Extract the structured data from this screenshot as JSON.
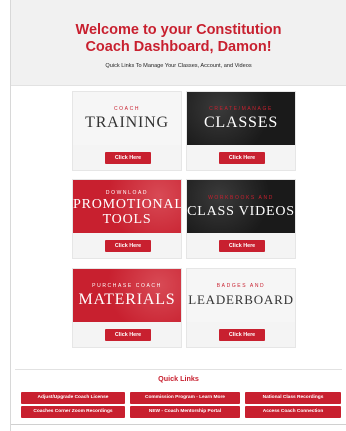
{
  "header": {
    "title_line1": "Welcome to your Constitution",
    "title_line2": "Coach Dashboard, Damon!",
    "subtitle": "Quick Links To Manage Your Classes, Account, and Videos"
  },
  "cards": [
    {
      "small": "COACH",
      "big": "TRAINING",
      "button": "Click Here"
    },
    {
      "small": "CREATE/MANAGE",
      "big": "CLASSES",
      "button": "Click Here"
    },
    {
      "small": "DOWNLOAD",
      "big": "PROMOTIONAL",
      "big2": "TOOLS",
      "button": "Click Here"
    },
    {
      "small": "WORKBOOKS AND",
      "big": "CLASS VIDEOS",
      "button": "Click Here"
    },
    {
      "small": "PURCHASE COACH",
      "big": "MATERIALS",
      "button": "Click Here"
    },
    {
      "small": "BADGES AND",
      "big": "LEADERBOARD",
      "button": "Click Here"
    }
  ],
  "quick_links": {
    "title": "Quick Links",
    "items": [
      "Adjust/Upgrade Coach License",
      "Commission Program - Learn More",
      "National Class Recordings",
      "Coaches Corner Zoom Recordings",
      "NEW - Coach Mentorship Portal",
      "Access Coach Connection"
    ]
  },
  "colors": {
    "brand_red": "#c8202f",
    "header_bg": "#f1f1f1"
  }
}
